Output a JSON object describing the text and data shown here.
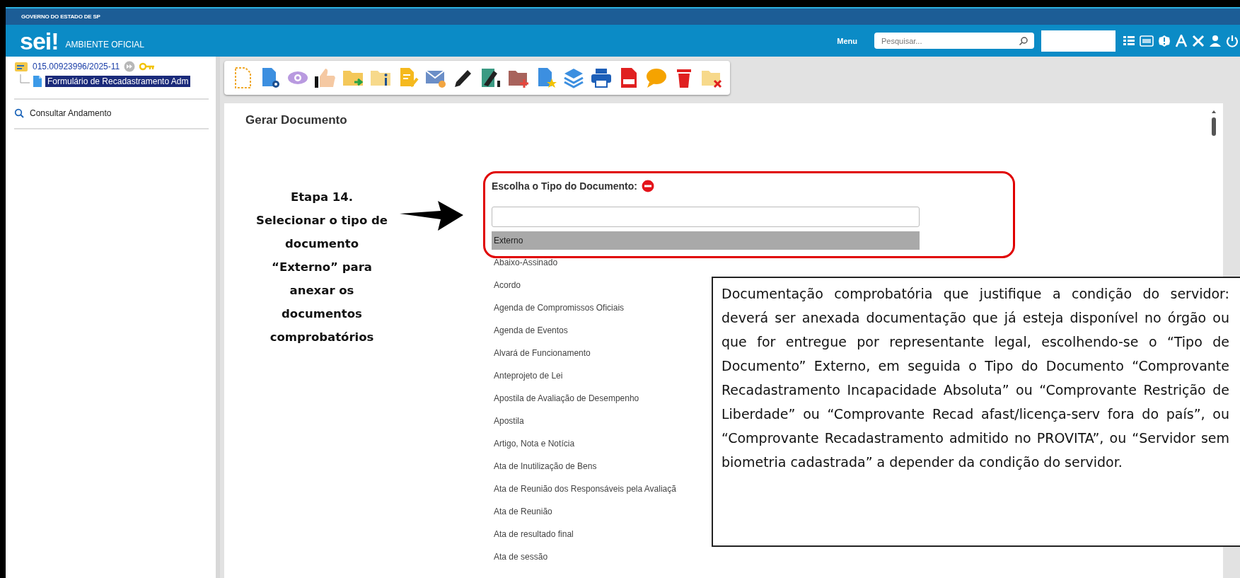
{
  "header": {
    "top_strip": "GOVERNO DO ESTADO DE SP",
    "logo": "sei!",
    "environment": "AMBIENTE OFICIAL",
    "menu": "Menu",
    "search": {
      "placeholder": "Pesquisar..."
    }
  },
  "sidebar": {
    "tree": [
      {
        "label": "015.00923996/2025-11",
        "selected": false,
        "children": [
          {
            "label": "Formulário de Recadastramento Adm",
            "selected": true
          }
        ]
      }
    ],
    "links": [
      "Consultar Andamento"
    ]
  },
  "content": {
    "title": "Gerar Documento",
    "field_label": "Escolha o Tipo do Documento:",
    "options": [
      {
        "label": "Externo",
        "selected": true
      },
      {
        "label": "Abaixo-Assinado",
        "selected": false
      },
      {
        "label": "Acordo",
        "selected": false
      },
      {
        "label": "Agenda de Compromissos Oficiais",
        "selected": false
      },
      {
        "label": "Agenda de Eventos",
        "selected": false
      },
      {
        "label": "Alvará de Funcionamento",
        "selected": false
      },
      {
        "label": "Anteprojeto de Lei",
        "selected": false
      },
      {
        "label": "Apostila de Avaliação de Desempenho",
        "selected": false
      },
      {
        "label": "Apostila",
        "selected": false
      },
      {
        "label": "Artigo, Nota e Notícia",
        "selected": false
      },
      {
        "label": "Ata de Inutilização de Bens",
        "selected": false
      },
      {
        "label": "Ata de Reunião dos Responsáveis pela Avaliaçã",
        "selected": false
      },
      {
        "label": "Ata de Reunião",
        "selected": false
      },
      {
        "label": "Ata de resultado final",
        "selected": false
      },
      {
        "label": "Ata de sessão",
        "selected": false
      }
    ]
  },
  "annotations": {
    "step": "Etapa 14.\nSelecionar o tipo de\ndocumento\n“Externo” para\nanexar os\ndocumentos\ncomprobatórios",
    "note": "Documentação comprobatória que justifique a condição do servidor: deverá ser anexada documentação que já esteja disponível no órgão ou que for entregue por representante legal, escolhendo-se o “Tipo de Documento” Externo, em seguida o Tipo do Documento “Comprovante Recadastramento Incapacidade Absoluta” ou “Comprovante Restrição de Liberdade” ou “Comprovante Recad afast/licença-serv fora do país”, ou “Comprovante Recadastramento admitido no PROVITA”, ou “Servidor sem biometria cadastrada” a depender da condição do servidor."
  }
}
